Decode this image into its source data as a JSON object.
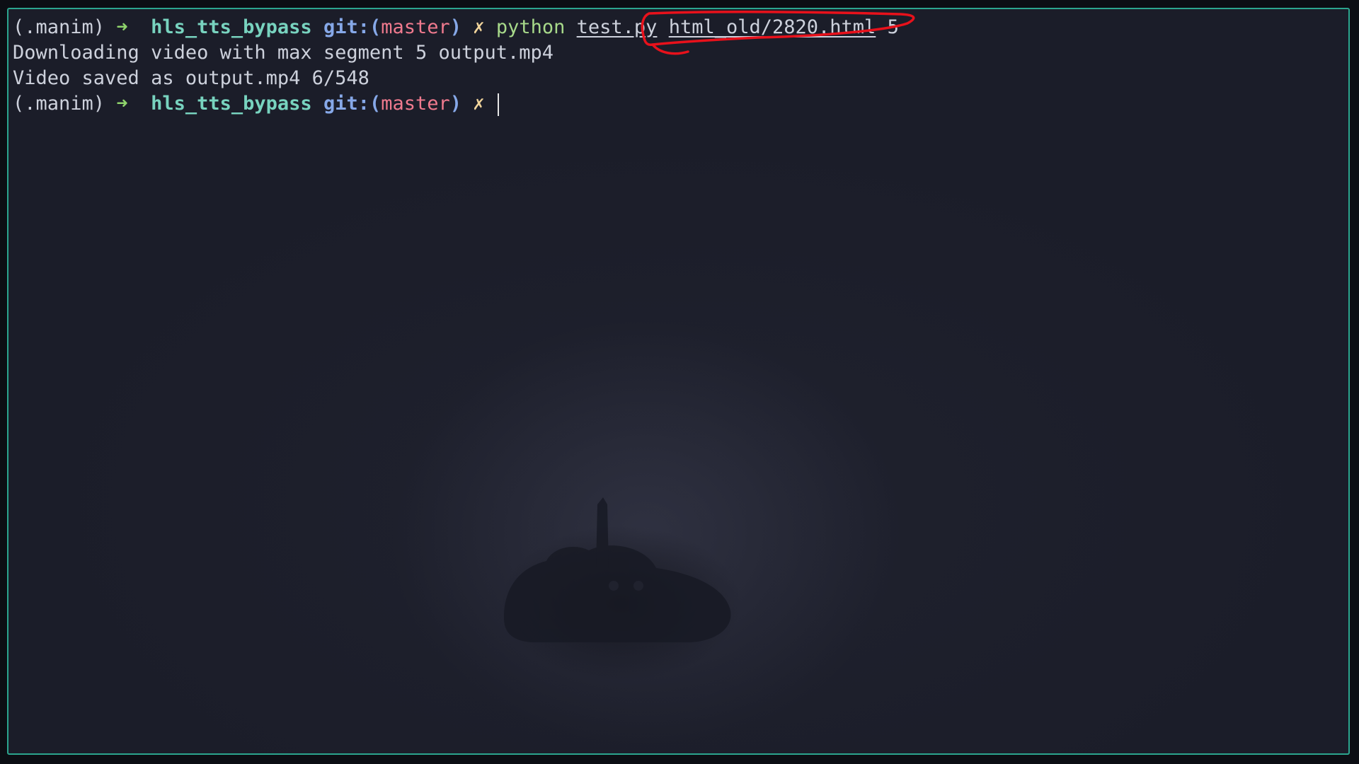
{
  "terminal": {
    "lines": [
      {
        "venv": "(.manim)",
        "arrow": "➜",
        "dir": "hls_tts_bypass",
        "git_label": "git:(",
        "branch": "master",
        "git_close": ")",
        "dirty": "✗",
        "cmd": "python",
        "script": "test.py",
        "file_arg": "html_old/2820.html",
        "num_arg": "5"
      },
      {
        "text": "Downloading video with max segment 5 output.mp4"
      },
      {
        "text": "Video saved as output.mp4 6/548"
      },
      {
        "venv": "(.manim)",
        "arrow": "➜",
        "dir": "hls_tts_bypass",
        "git_label": "git:(",
        "branch": "master",
        "git_close": ")",
        "dirty": "✗"
      }
    ]
  },
  "colors": {
    "border": "#2ba58e",
    "background": "#1b1d29",
    "annotation": "#e8111b"
  }
}
